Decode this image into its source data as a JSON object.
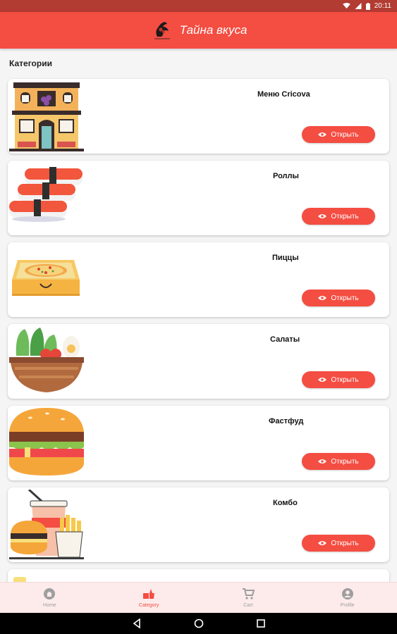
{
  "status_bar": {
    "time": "20:11"
  },
  "app_bar": {
    "title": "Тайна вкуса"
  },
  "section_label": "Категории",
  "categories": [
    {
      "title": "Меню Cricova",
      "button": "Открыть"
    },
    {
      "title": "Роллы",
      "button": "Открыть"
    },
    {
      "title": "Пиццы",
      "button": "Открыть"
    },
    {
      "title": "Салаты",
      "button": "Открыть"
    },
    {
      "title": "Фастфуд",
      "button": "Открыть"
    },
    {
      "title": "Комбо",
      "button": "Открыть"
    }
  ],
  "bottom_nav": [
    {
      "label": "Home",
      "icon": "home-icon",
      "active": false
    },
    {
      "label": "Category",
      "icon": "category-icon",
      "active": true
    },
    {
      "label": "Cart",
      "icon": "cart-icon",
      "active": false
    },
    {
      "label": "Profile",
      "icon": "profile-icon",
      "active": false
    }
  ],
  "colors": {
    "primary": "#f44d42",
    "status_bar": "#b23b32",
    "nav_background": "#fcebea"
  }
}
